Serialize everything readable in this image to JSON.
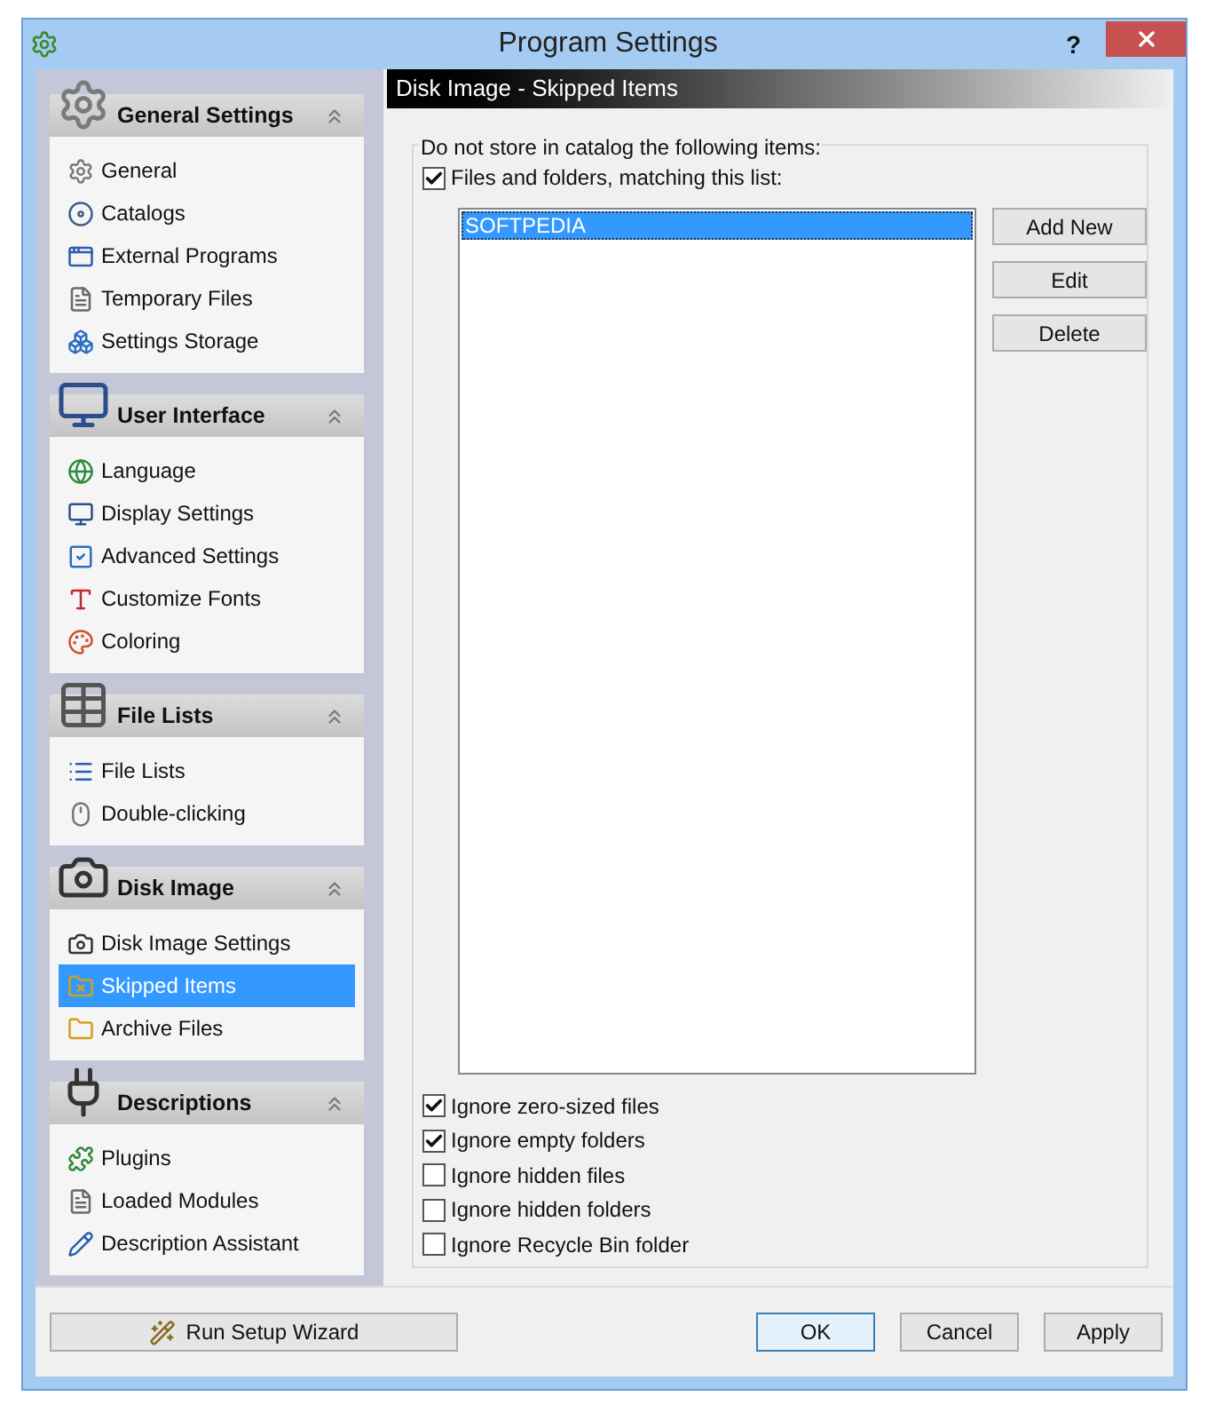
{
  "window": {
    "title": "Program Settings",
    "help": "?"
  },
  "sidebar": {
    "sections": [
      {
        "title": "General Settings",
        "items": [
          {
            "label": "General",
            "selected": false
          },
          {
            "label": "Catalogs",
            "selected": false
          },
          {
            "label": "External Programs",
            "selected": false
          },
          {
            "label": "Temporary Files",
            "selected": false
          },
          {
            "label": "Settings Storage",
            "selected": false
          }
        ]
      },
      {
        "title": "User Interface",
        "items": [
          {
            "label": "Language",
            "selected": false
          },
          {
            "label": "Display Settings",
            "selected": false
          },
          {
            "label": "Advanced Settings",
            "selected": false
          },
          {
            "label": "Customize Fonts",
            "selected": false
          },
          {
            "label": "Coloring",
            "selected": false
          }
        ]
      },
      {
        "title": "File Lists",
        "items": [
          {
            "label": "File Lists",
            "selected": false
          },
          {
            "label": "Double-clicking",
            "selected": false
          }
        ]
      },
      {
        "title": "Disk Image",
        "items": [
          {
            "label": "Disk Image Settings",
            "selected": false
          },
          {
            "label": "Skipped Items",
            "selected": true
          },
          {
            "label": "Archive Files",
            "selected": false
          }
        ]
      },
      {
        "title": "Descriptions",
        "items": [
          {
            "label": "Plugins",
            "selected": false
          },
          {
            "label": "Loaded Modules",
            "selected": false
          },
          {
            "label": "Description Assistant",
            "selected": false
          }
        ]
      }
    ]
  },
  "panel": {
    "title": "Disk Image - Skipped Items",
    "group_label": "Do not store in catalog the following items:",
    "match_list": {
      "label": "Files and folders, matching this list:",
      "checked": true
    },
    "patterns": [
      {
        "text": "SOFTPEDIA",
        "selected": true
      }
    ],
    "list_buttons": [
      "Add New",
      "Edit",
      "Delete"
    ],
    "options": [
      {
        "label": "Ignore zero-sized files",
        "checked": true
      },
      {
        "label": "Ignore empty folders",
        "checked": true
      },
      {
        "label": "Ignore hidden files",
        "checked": false
      },
      {
        "label": "Ignore hidden folders",
        "checked": false
      },
      {
        "label": "Ignore Recycle Bin folder",
        "checked": false
      }
    ]
  },
  "footer": {
    "wizard": "Run Setup Wizard",
    "buttons": [
      {
        "label": "OK",
        "default": true
      },
      {
        "label": "Cancel",
        "default": false
      },
      {
        "label": "Apply",
        "default": false
      }
    ]
  }
}
